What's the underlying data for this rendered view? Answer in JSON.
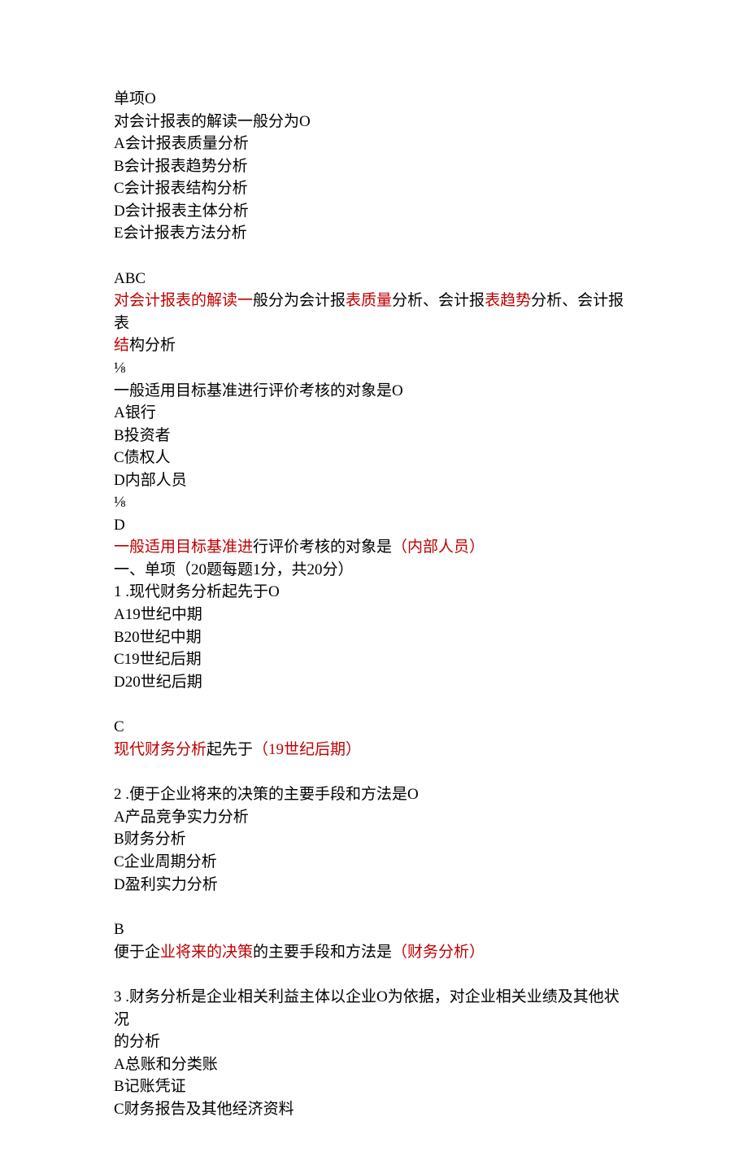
{
  "lines": [
    {
      "segments": [
        {
          "text": "单项O"
        }
      ]
    },
    {
      "segments": [
        {
          "text": "对会计报表的解读一般分为O"
        }
      ]
    },
    {
      "segments": [
        {
          "text": "A会计报表质量分析"
        }
      ]
    },
    {
      "segments": [
        {
          "text": "B会计报表趋势分析"
        }
      ]
    },
    {
      "segments": [
        {
          "text": "C会计报表结构分析"
        }
      ]
    },
    {
      "segments": [
        {
          "text": "D会计报表主体分析"
        }
      ]
    },
    {
      "segments": [
        {
          "text": "E会计报表方法分析"
        }
      ]
    },
    {
      "blank": true
    },
    {
      "segments": [
        {
          "text": "ABC"
        }
      ]
    },
    {
      "segments": [
        {
          "text": "对会计报表的解读一",
          "red": true
        },
        {
          "text": "般分为会计报"
        },
        {
          "text": "表质量",
          "red": true
        },
        {
          "text": "分析、会计报"
        },
        {
          "text": "表趋势",
          "red": true
        },
        {
          "text": "分析、会计报表"
        }
      ]
    },
    {
      "segments": [
        {
          "text": "结",
          "red": true
        },
        {
          "text": "构分析"
        }
      ]
    },
    {
      "segments": [
        {
          "text": "⅛"
        }
      ]
    },
    {
      "segments": [
        {
          "text": "一般适用目标基准进行评价考核的对象是O"
        }
      ]
    },
    {
      "segments": [
        {
          "text": "A银行"
        }
      ]
    },
    {
      "segments": [
        {
          "text": "B投资者"
        }
      ]
    },
    {
      "segments": [
        {
          "text": "C债权人"
        }
      ]
    },
    {
      "segments": [
        {
          "text": "D内部人员"
        }
      ]
    },
    {
      "segments": [
        {
          "text": "⅛"
        }
      ]
    },
    {
      "segments": [
        {
          "text": "D"
        }
      ]
    },
    {
      "segments": [
        {
          "text": "一般适用目标基准进",
          "red": true
        },
        {
          "text": "行评价考核的对象是"
        },
        {
          "text": "（内部人员）",
          "red": true
        }
      ]
    },
    {
      "segments": [
        {
          "text": "一、单项（20题每题1分，共20分）"
        }
      ]
    },
    {
      "segments": [
        {
          "text": "1 .现代财务分析起先于O"
        }
      ]
    },
    {
      "segments": [
        {
          "text": "A19世纪中期"
        }
      ]
    },
    {
      "segments": [
        {
          "text": "B20世纪中期"
        }
      ]
    },
    {
      "segments": [
        {
          "text": "C19世纪后期"
        }
      ]
    },
    {
      "segments": [
        {
          "text": "D20世纪后期"
        }
      ]
    },
    {
      "blank": true
    },
    {
      "segments": [
        {
          "text": "C"
        }
      ]
    },
    {
      "segments": [
        {
          "text": "现代财务分析",
          "red": true
        },
        {
          "text": "起先于"
        },
        {
          "text": "（19世纪后期）",
          "red": true
        }
      ]
    },
    {
      "blank": true
    },
    {
      "segments": [
        {
          "text": "2 .便于企业将来的决策的主要手段和方法是O"
        }
      ]
    },
    {
      "segments": [
        {
          "text": "A产品竞争实力分析"
        }
      ]
    },
    {
      "segments": [
        {
          "text": "B财务分析"
        }
      ]
    },
    {
      "segments": [
        {
          "text": "C企业周期分析"
        }
      ]
    },
    {
      "segments": [
        {
          "text": "D盈利实力分析"
        }
      ]
    },
    {
      "blank": true
    },
    {
      "segments": [
        {
          "text": "B"
        }
      ]
    },
    {
      "segments": [
        {
          "text": "便于企"
        },
        {
          "text": "业将来的决策",
          "red": true
        },
        {
          "text": "的主要手段和方法是"
        },
        {
          "text": "（财务分析）",
          "red": true
        }
      ]
    },
    {
      "blank": true
    },
    {
      "segments": [
        {
          "text": "3 .财务分析是企业相关利益主体以企业O为依据，对企业相关业绩及其他状况"
        }
      ]
    },
    {
      "segments": [
        {
          "text": "的分析"
        }
      ]
    },
    {
      "segments": [
        {
          "text": "A总账和分类账"
        }
      ]
    },
    {
      "segments": [
        {
          "text": "B记账凭证"
        }
      ]
    },
    {
      "segments": [
        {
          "text": "C财务报告及其他经济资料"
        }
      ]
    }
  ]
}
